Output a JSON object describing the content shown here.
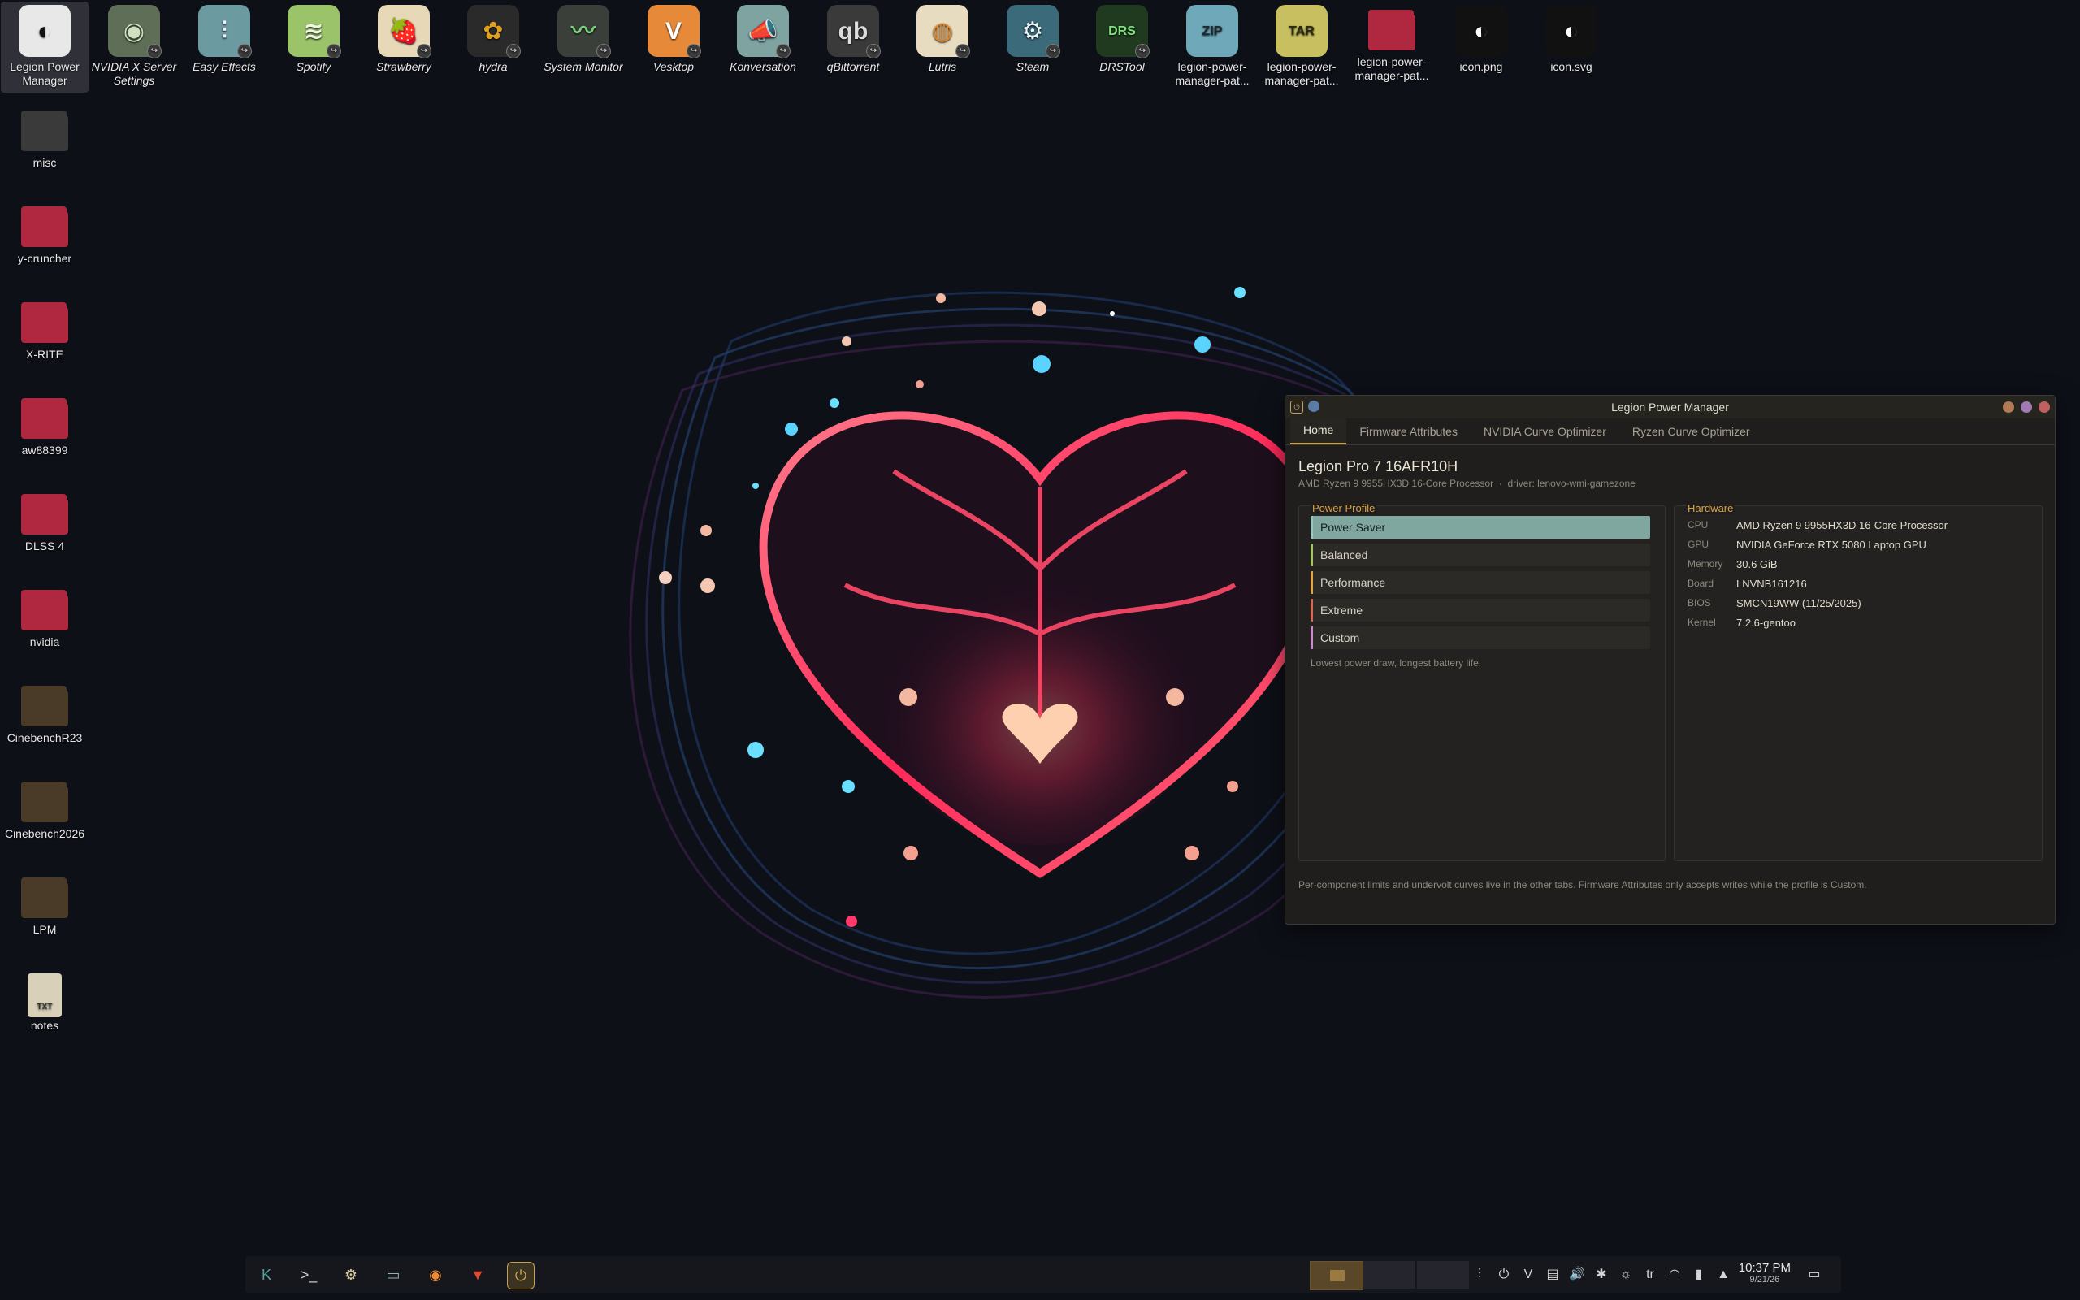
{
  "desktop_top": [
    {
      "name": "legion-power-manager",
      "label": "Legion Power Manager",
      "glyph": "◐",
      "bg": "#e8e8e8",
      "fg": "#111",
      "selected": true,
      "italic": false
    },
    {
      "name": "nvidia-x-server-settings",
      "label": "NVIDIA X Server Settings",
      "glyph": "◉",
      "bg": "#5f6f57",
      "fg": "#cfe0c0",
      "italic": true
    },
    {
      "name": "easy-effects",
      "label": "Easy Effects",
      "glyph": "⫶",
      "bg": "#6b9aa0",
      "fg": "#eef",
      "italic": true
    },
    {
      "name": "spotify",
      "label": "Spotify",
      "glyph": "≋",
      "bg": "#9bc46a",
      "fg": "#eef6e0",
      "italic": true
    },
    {
      "name": "strawberry",
      "label": "Strawberry",
      "glyph": "🍓",
      "bg": "#e7d8b8",
      "fg": "#c33",
      "italic": true
    },
    {
      "name": "hydra",
      "label": "hydra",
      "glyph": "✿",
      "bg": "#2a2a2a",
      "fg": "#e0a020",
      "italic": true
    },
    {
      "name": "system-monitor",
      "label": "System Monitor",
      "glyph": "〰",
      "bg": "#3a3f3a",
      "fg": "#7fcf80",
      "italic": true
    },
    {
      "name": "vesktop",
      "label": "Vesktop",
      "glyph": "V",
      "bg": "#e68a3a",
      "fg": "#fff",
      "italic": true
    },
    {
      "name": "konversation",
      "label": "Konversation",
      "glyph": "📣",
      "bg": "#7fa3a0",
      "fg": "#fff",
      "italic": true
    },
    {
      "name": "qbittorrent",
      "label": "qBittorrent",
      "glyph": "qb",
      "bg": "#3a3a3a",
      "fg": "#ddd",
      "italic": true
    },
    {
      "name": "lutris",
      "label": "Lutris",
      "glyph": "◍",
      "bg": "#e8dcc0",
      "fg": "#e08a30",
      "italic": true
    },
    {
      "name": "steam",
      "label": "Steam",
      "glyph": "⚙",
      "bg": "#3b6a7a",
      "fg": "#e8f4f8",
      "italic": true
    },
    {
      "name": "drstool",
      "label": "DRSTool",
      "glyph": "DRS",
      "bg": "#1f3a1f",
      "fg": "#7fe07f",
      "italic": true
    },
    {
      "name": "legion-power-manager-pat-zip",
      "label": "legion-power-manager-pat...",
      "glyph": "ZIP",
      "bg": "#6fa8b8",
      "fg": "#1a2a30",
      "italic": false
    },
    {
      "name": "legion-power-manager-pat-tar",
      "label": "legion-power-manager-pat...",
      "glyph": "TAR",
      "bg": "#c8c060",
      "fg": "#2a2a10",
      "italic": false
    },
    {
      "name": "legion-power-manager-pat-folder",
      "label": "legion-power-manager-pat...",
      "glyph": "",
      "bg": "#b02840",
      "fg": "#fff",
      "italic": false,
      "folder": true
    },
    {
      "name": "icon-png",
      "label": "icon.png",
      "glyph": "◐",
      "bg": "#111",
      "fg": "#fff",
      "italic": false
    },
    {
      "name": "icon-svg",
      "label": "icon.svg",
      "glyph": "◐",
      "bg": "#111",
      "fg": "#fff",
      "italic": false
    }
  ],
  "desktop_left": [
    {
      "name": "misc",
      "label": "misc",
      "color": "#3a3a3a"
    },
    {
      "name": "y-cruncher",
      "label": "y-cruncher",
      "color": "#b02840"
    },
    {
      "name": "x-rite",
      "label": "X-RITE",
      "color": "#b02840"
    },
    {
      "name": "aw88399",
      "label": "aw88399",
      "color": "#b02840"
    },
    {
      "name": "dlss-4",
      "label": "DLSS 4",
      "color": "#b02840"
    },
    {
      "name": "nvidia",
      "label": "nvidia",
      "color": "#b02840"
    },
    {
      "name": "cinebenchr23",
      "label": "CinebenchR23",
      "color": "#4a3a28"
    },
    {
      "name": "cinebench2026",
      "label": "Cinebench2026",
      "color": "#4a3a28"
    },
    {
      "name": "lpm",
      "label": "LPM",
      "color": "#4a3a28"
    },
    {
      "name": "notes",
      "label": "notes",
      "color": "#d8d0b8",
      "file": true,
      "file_tag": "TXT"
    }
  ],
  "window": {
    "title": "Legion Power Manager",
    "tabs": [
      "Home",
      "Firmware Attributes",
      "NVIDIA Curve Optimizer",
      "Ryzen Curve Optimizer"
    ],
    "active_tab": 0,
    "device_title": "Legion Pro 7 16AFR10H",
    "device_cpu": "AMD Ryzen 9 9955HX3D 16-Core Processor",
    "device_sep": "·",
    "device_driver": "driver: lenovo-wmi-gamezone",
    "power_profile_title": "Power Profile",
    "profiles": [
      "Power Saver",
      "Balanced",
      "Performance",
      "Extreme",
      "Custom"
    ],
    "selected_profile": 0,
    "profile_description": "Lowest power draw, longest battery life.",
    "hardware_title": "Hardware",
    "hardware": [
      {
        "key": "CPU",
        "value": "AMD Ryzen 9 9955HX3D 16-Core Processor"
      },
      {
        "key": "GPU",
        "value": "NVIDIA GeForce RTX 5080 Laptop GPU"
      },
      {
        "key": "Memory",
        "value": "30.6 GiB"
      },
      {
        "key": "Board",
        "value": "LNVNB161216"
      },
      {
        "key": "BIOS",
        "value": "SMCN19WW (11/25/2025)"
      },
      {
        "key": "Kernel",
        "value": "7.2.6-gentoo"
      }
    ],
    "footnote": "Per-component limits and undervolt curves live in the other tabs. Firmware Attributes only accepts writes while the profile is Custom."
  },
  "taskbar": {
    "apps": [
      {
        "name": "kde-launcher",
        "glyph": "K",
        "color": "#4fa3a0"
      },
      {
        "name": "terminal",
        "glyph": ">_",
        "color": "#cfcfcf"
      },
      {
        "name": "settings",
        "glyph": "⚙",
        "color": "#e0c89a"
      },
      {
        "name": "files",
        "glyph": "▭",
        "color": "#8fb8a8"
      },
      {
        "name": "firefox",
        "glyph": "◉",
        "color": "#f08a30"
      },
      {
        "name": "brave",
        "glyph": "▼",
        "color": "#e04a30"
      },
      {
        "name": "legion-power-manager",
        "glyph": "⏻",
        "color": "#c9a050",
        "active": true
      }
    ],
    "tray": [
      {
        "name": "mixer-icon",
        "glyph": "⫶"
      },
      {
        "name": "power-manager-tray-icon",
        "glyph": "⏻"
      },
      {
        "name": "vesktop-tray-icon",
        "glyph": "V"
      },
      {
        "name": "clipboard-icon",
        "glyph": "▤"
      },
      {
        "name": "volume-icon",
        "glyph": "🔊"
      },
      {
        "name": "bluetooth-icon",
        "glyph": "✱"
      },
      {
        "name": "brightness-icon",
        "glyph": "☼"
      },
      {
        "name": "keyboard-layout-icon",
        "glyph": "tr"
      },
      {
        "name": "wifi-icon",
        "glyph": "◠"
      },
      {
        "name": "battery-icon",
        "glyph": "▮"
      },
      {
        "name": "expand-tray-icon",
        "glyph": "▲"
      }
    ],
    "time": "10:37 PM",
    "date": "9/21/26",
    "show_desktop_glyph": "▭"
  }
}
